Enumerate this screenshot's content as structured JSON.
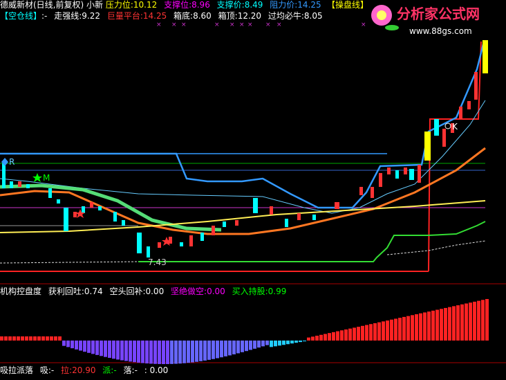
{
  "colors": {
    "white": "#ffffff",
    "yellow": "#ffff00",
    "cyan": "#00ffff",
    "green": "#00ff00",
    "magenta": "#ff00ff",
    "red": "#ff3333",
    "blue": "#3399ff",
    "lightgreen": "#66ff66",
    "pink": "#ff66ff"
  },
  "header": {
    "title": "德威新材(日线,前复权) 小新",
    "pressure_label": "压力位:",
    "pressure_value": "10.12",
    "support1_label": "支撑位:",
    "support1_value": "8.96",
    "support2_label": "支撑价:",
    "support2_value": "8.49",
    "resistance_label": "阻力价:",
    "resistance_value": "14.25",
    "panel_button": "【操盘线】"
  },
  "subheader": {
    "empty_line_label": "【空仓线】",
    "empty_line_value": ":-",
    "strong_label": "走强线:",
    "strong_value": "9.22",
    "volume_platform_label": "巨量平台:",
    "volume_platform_value": "14.25",
    "box_bottom_label": "箱底:",
    "box_bottom_value": "8.60",
    "box_top_label": "箱顶:",
    "box_top_value": "12.20",
    "bull_label": "过均必牛:",
    "bull_value": "8.05"
  },
  "markers": {
    "r_label": "R",
    "m_label": "M",
    "k_label": "K",
    "low_label": "7.43"
  },
  "indicator1": {
    "control_label": "机构控盘度",
    "profit_label": "获利回吐:",
    "profit_value": "0.74",
    "short_label": "空头回补:",
    "short_value": "0.00",
    "firm_short_label": "坚绝做空:",
    "firm_short_value": "0.00",
    "buy_hold_label": "买入持股:",
    "buy_hold_value": "0.99"
  },
  "indicator2": {
    "title": "吸拉派落",
    "suck_label": "吸:",
    "suck_value": "-",
    "pull_label": "拉:",
    "pull_value": "20.90",
    "dispatch_label": "派:",
    "dispatch_value": "-",
    "fall_label": "落:",
    "fall_value": "-",
    "extra_value": ": 0.00"
  },
  "logo": {
    "text": "分析家公式网",
    "url": "www.88gs.com"
  }
}
